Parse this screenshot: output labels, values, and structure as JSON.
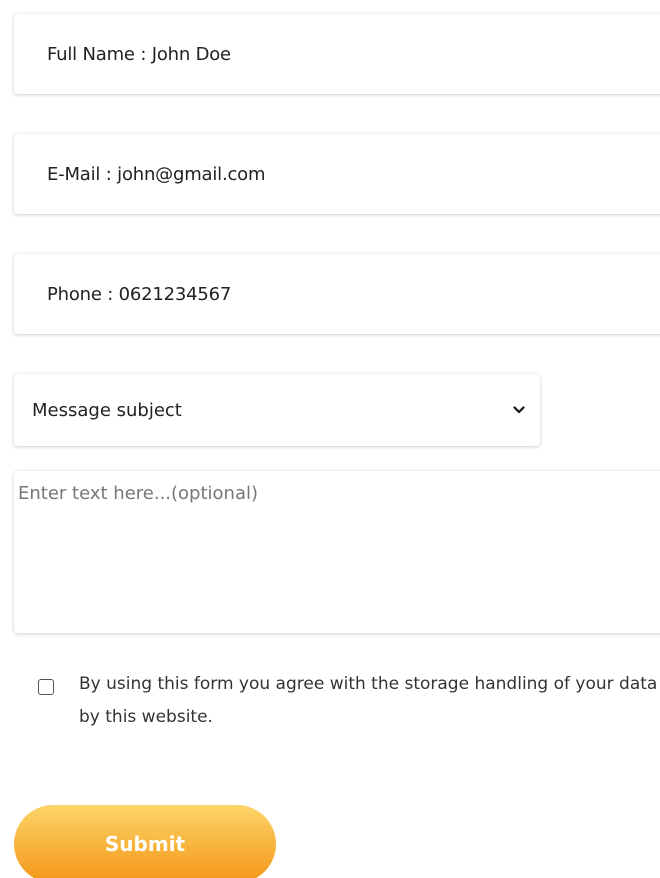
{
  "form": {
    "full_name": "Full Name : John Doe",
    "email": "E-Mail : john@gmail.com",
    "phone": "Phone : 0621234567",
    "subject": {
      "selected": "Message subject",
      "icon": "chevron-down-icon"
    },
    "message_placeholder": "Enter text here...(optional)",
    "consent": {
      "checked": false,
      "label": "By using this form you agree with the storage handling of your data by this website."
    },
    "submit_label": "Submit"
  },
  "colors": {
    "button_gradient_top": "#fbd56a",
    "button_gradient_bottom": "#f3971a",
    "button_text": "#ffffff"
  }
}
